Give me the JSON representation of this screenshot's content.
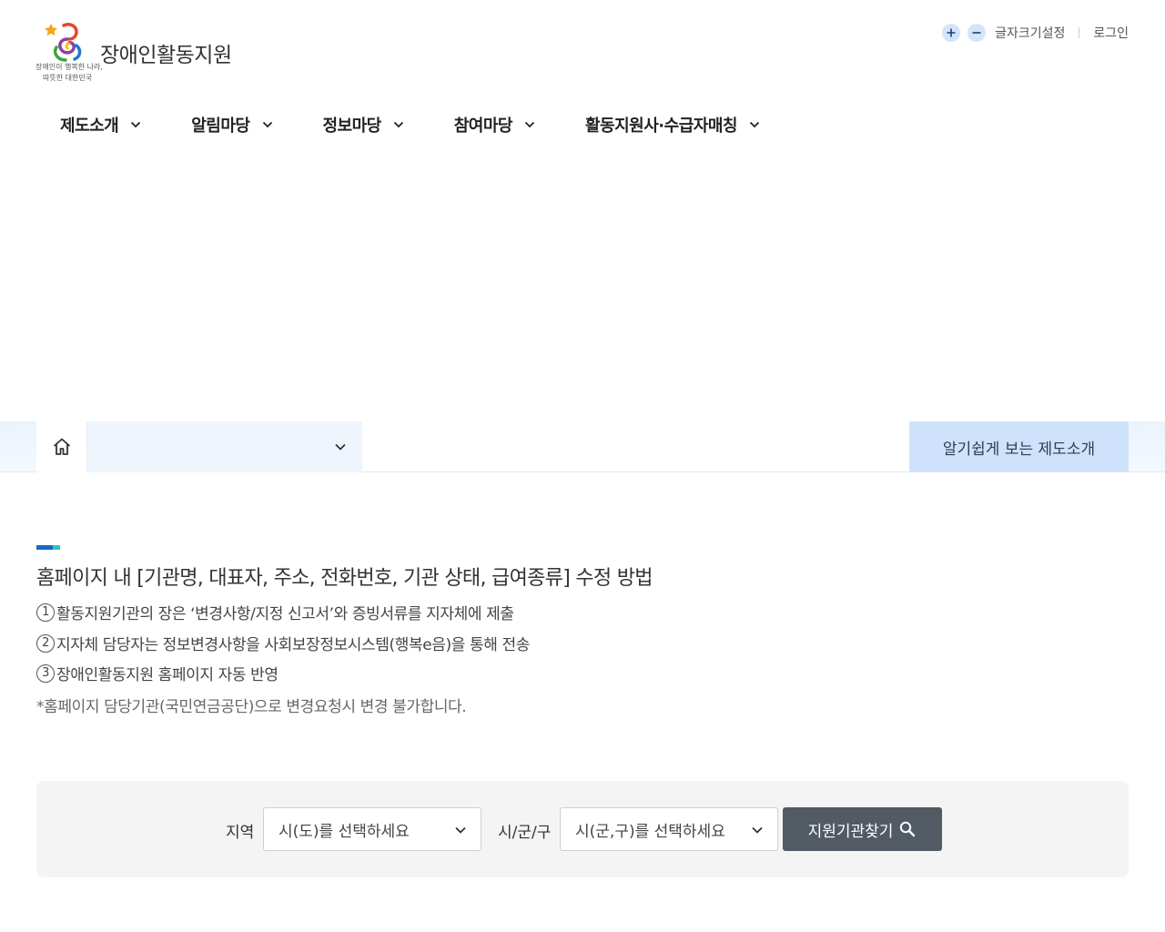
{
  "header": {
    "site_title": "장애인활동지원",
    "slogan_line1": "장애인이 행복한 나라,",
    "slogan_line2": "따뜻한 대한민국",
    "font_size_label": "글자크기설정",
    "login_label": "로그인",
    "icons": {
      "increase": "plus-icon",
      "decrease": "minus-icon"
    }
  },
  "nav": {
    "items": [
      {
        "label": "제도소개"
      },
      {
        "label": "알림마당"
      },
      {
        "label": "정보마당"
      },
      {
        "label": "참여마당"
      },
      {
        "label": "활동지원사·수급자매칭"
      }
    ]
  },
  "breadcrumb": {
    "selected": "",
    "easy_button": "알기쉽게 보는 제도소개"
  },
  "notice": {
    "title": "홈페이지 내 [기관명, 대표자, 주소, 전화번호, 기관 상태, 급여종류] 수정 방법",
    "steps": [
      {
        "num": "1",
        "text": "활동지원기관의 장은 ‘변경사항/지정 신고서’와 증빙서류를 지자체에 제출"
      },
      {
        "num": "2",
        "text": "지자체 담당자는 정보변경사항을 사회보장정보시스템(행복e음)을 통해 전송"
      },
      {
        "num": "3",
        "text": "장애인활동지원 홈페이지 자동 반영"
      }
    ],
    "note": "*홈페이지 담당기관(국민연금공단)으로 변경요청시 변경 불가합니다."
  },
  "search": {
    "region_label": "지역",
    "region_placeholder": "시(도)를 선택하세요",
    "district_label": "시/군/구",
    "district_placeholder": "시(군,구)를 선택하세요",
    "button_label": "지원기관찾기"
  },
  "colors": {
    "accent_blue": "#1769c4",
    "accent_teal": "#21c6c9",
    "easy_button_bg": "#cfe2fb",
    "search_button_bg": "#525a64"
  }
}
